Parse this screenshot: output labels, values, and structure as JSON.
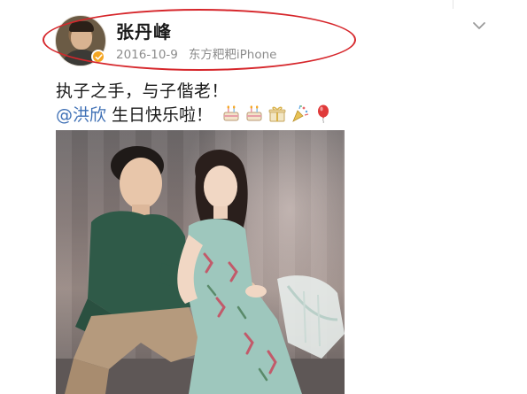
{
  "post": {
    "username": "张丹峰",
    "date": "2016-10-9",
    "source": "东方粑粑iPhone",
    "text_line1": "执子之手，与子偕老！",
    "mention": "@洪欣",
    "greeting": "生日快乐啦！",
    "emojis": [
      "cake-icon",
      "cake-icon",
      "gift-icon",
      "party-popper-icon",
      "balloon-icon"
    ]
  },
  "colors": {
    "highlight_ellipse": "#d6262b",
    "mention": "#3f70b5",
    "verified_badge": "#f5a623",
    "meta_text": "#8c8c8c"
  }
}
